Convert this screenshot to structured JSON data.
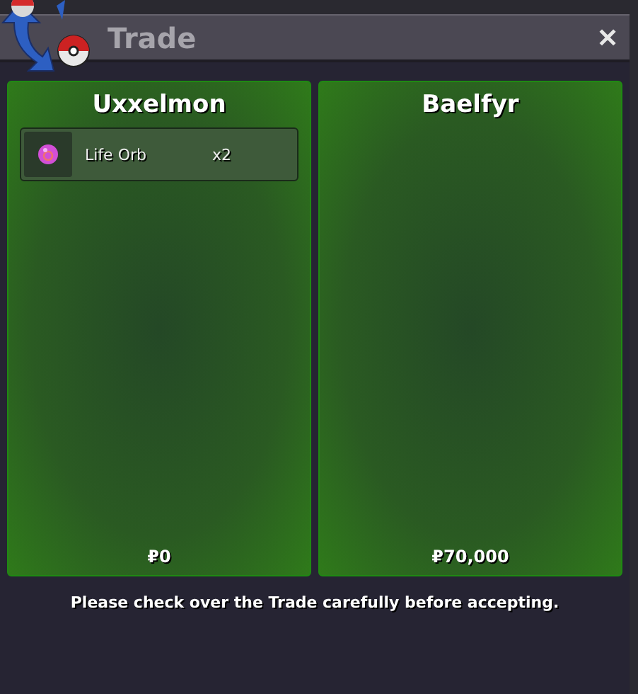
{
  "window": {
    "title": "Trade",
    "close": "✕"
  },
  "offers": [
    {
      "player": "Uxxelmon",
      "items": [
        {
          "name": "Life Orb",
          "quantity": "x2"
        }
      ],
      "money": "₽0"
    },
    {
      "player": "Baelfyr",
      "money": "₽70,000"
    }
  ],
  "notice": "Please check over the Trade carefully before accepting."
}
